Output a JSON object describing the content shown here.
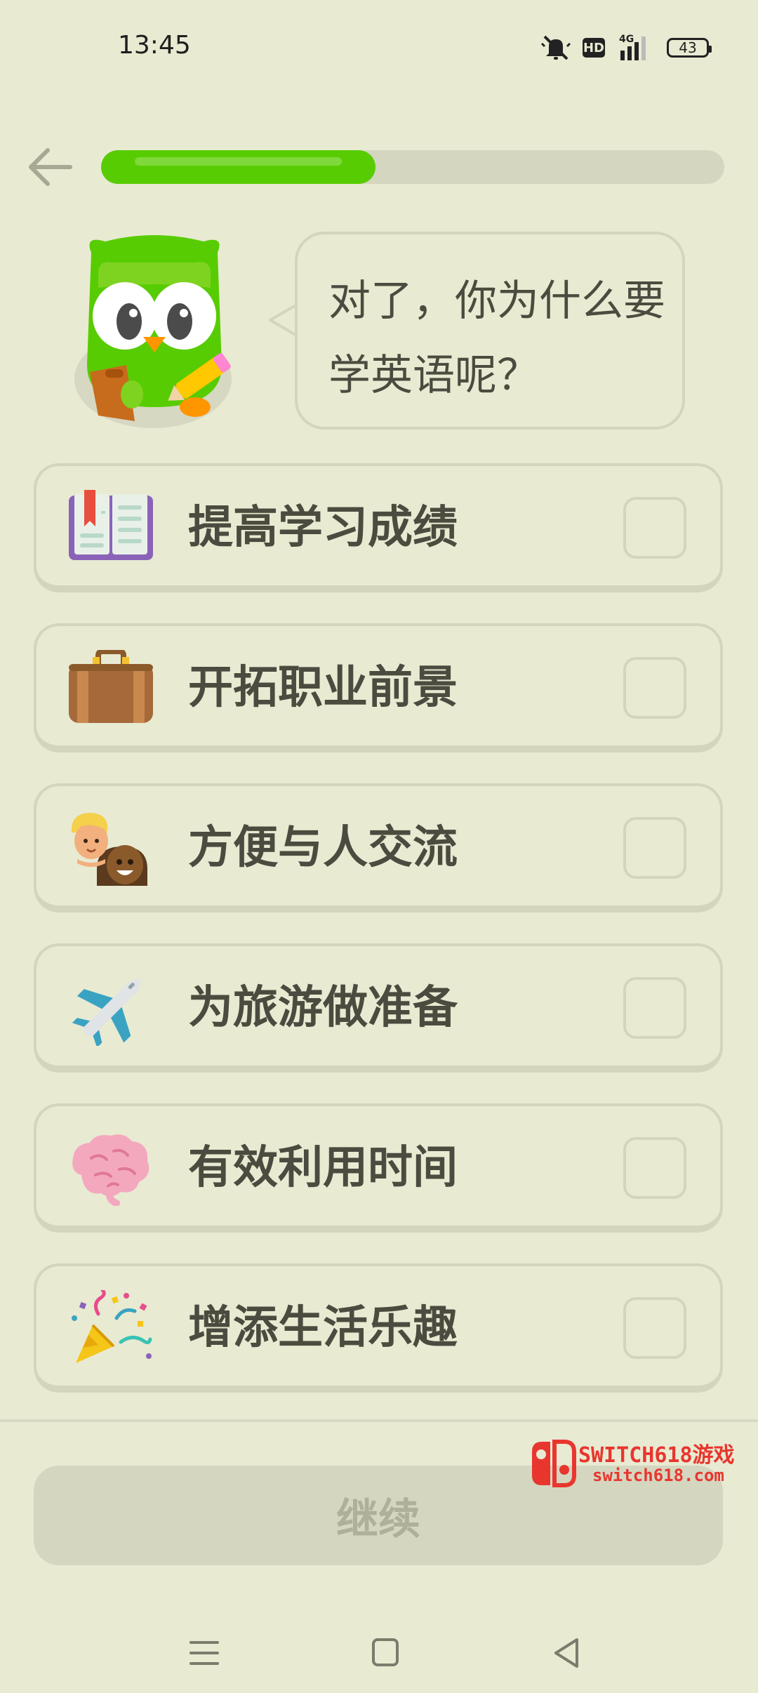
{
  "status_bar": {
    "time": "13:45",
    "hd": "HD",
    "network": "4G",
    "battery": "43"
  },
  "progress": {
    "fraction": 0.44
  },
  "prompt": {
    "text": "对了，你为什么要学英语呢？"
  },
  "options": [
    {
      "label": "提高学习成绩",
      "icon": "book-icon",
      "checked": false
    },
    {
      "label": "开拓职业前景",
      "icon": "briefcase-icon",
      "checked": false
    },
    {
      "label": "方便与人交流",
      "icon": "people-icon",
      "checked": false
    },
    {
      "label": "为旅游做准备",
      "icon": "airplane-icon",
      "checked": false
    },
    {
      "label": "有效利用时间",
      "icon": "brain-icon",
      "checked": false
    },
    {
      "label": "增添生活乐趣",
      "icon": "party-popper-icon",
      "checked": false
    }
  ],
  "continue_label": "继续",
  "watermark": {
    "title": "SWITCH618游戏",
    "url": "switch618.com"
  },
  "colors": {
    "background": "#e8ead2",
    "progress": "#58cc02",
    "border": "#d3d5bd",
    "text": "#4b4b3f"
  }
}
